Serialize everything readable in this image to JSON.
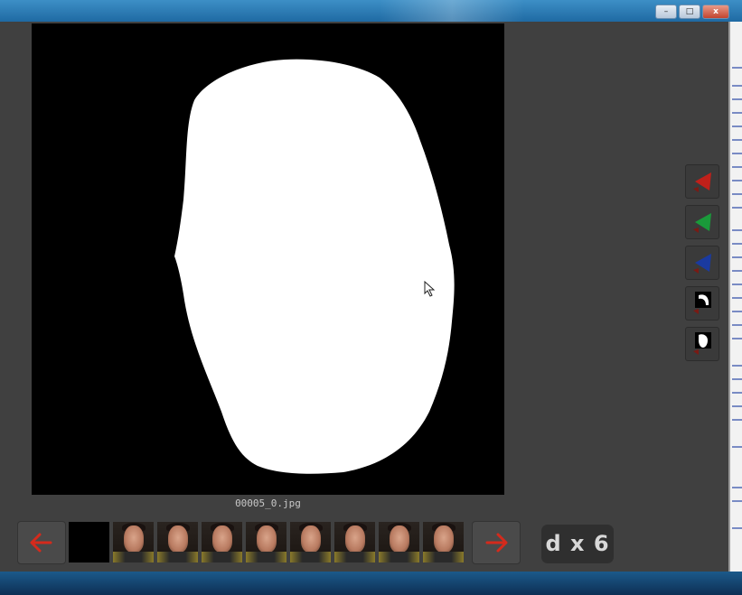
{
  "window": {
    "controls": {
      "minimize": "–",
      "maximize": "□",
      "close": "x"
    }
  },
  "canvas": {
    "filename": "00005_0.jpg",
    "mask_color": "#ffffff",
    "background_color": "#000000"
  },
  "tools": [
    {
      "name": "red-channel",
      "icon": "red-cone-icon",
      "color": "#c0201a"
    },
    {
      "name": "green-channel",
      "icon": "green-cone-icon",
      "color": "#1a9a3a"
    },
    {
      "name": "blue-channel",
      "icon": "blue-cone-icon",
      "color": "#1a3aa0"
    },
    {
      "name": "mask-edit",
      "icon": "mask-edge-icon",
      "color": "#ffffff"
    },
    {
      "name": "mask-fill",
      "icon": "mask-shape-icon",
      "color": "#ffffff"
    }
  ],
  "navigation": {
    "prev_icon": "left-arrow-icon",
    "next_icon": "right-arrow-icon",
    "arrow_color": "#d42a1c"
  },
  "thumbnails": [
    {
      "kind": "mask"
    },
    {
      "kind": "face"
    },
    {
      "kind": "face"
    },
    {
      "kind": "face"
    },
    {
      "kind": "face"
    },
    {
      "kind": "face"
    },
    {
      "kind": "face"
    },
    {
      "kind": "face"
    },
    {
      "kind": "face"
    }
  ],
  "badge": {
    "label": "d x 6"
  }
}
